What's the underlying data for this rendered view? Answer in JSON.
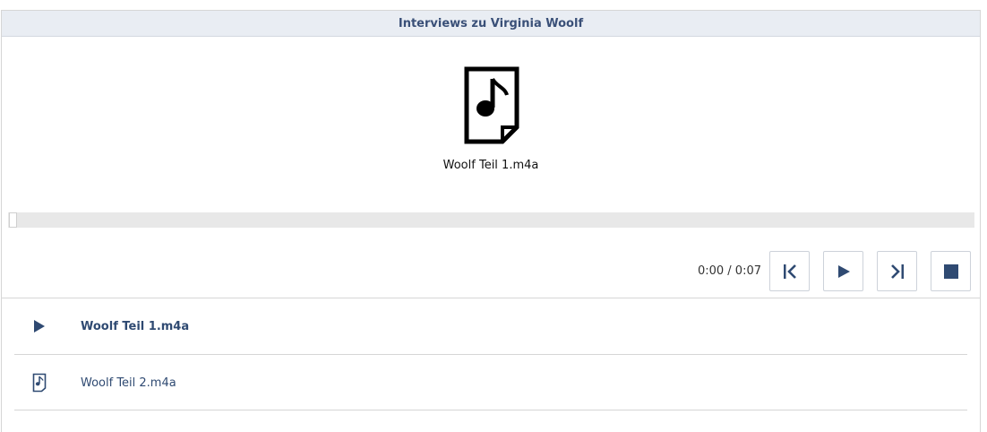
{
  "header": {
    "title": "Interviews zu Virginia Woolf"
  },
  "preview": {
    "file_name": "Woolf Teil 1.m4a",
    "icon": "music-file-icon"
  },
  "progress": {
    "value": 0
  },
  "controls": {
    "time": "0:00 / 0:07",
    "buttons": [
      "previous-icon",
      "play-icon",
      "next-icon",
      "stop-icon"
    ]
  },
  "playlist": {
    "items": [
      {
        "label": "Woolf Teil 1.m4a",
        "icon": "play-icon",
        "active": true
      },
      {
        "label": "Woolf Teil 2.m4a",
        "icon": "music-file-icon",
        "active": false
      }
    ]
  },
  "colors": {
    "accent": "#2f4a72",
    "header_bg": "#e9edf3",
    "progress_bg": "#e8e8e8"
  }
}
